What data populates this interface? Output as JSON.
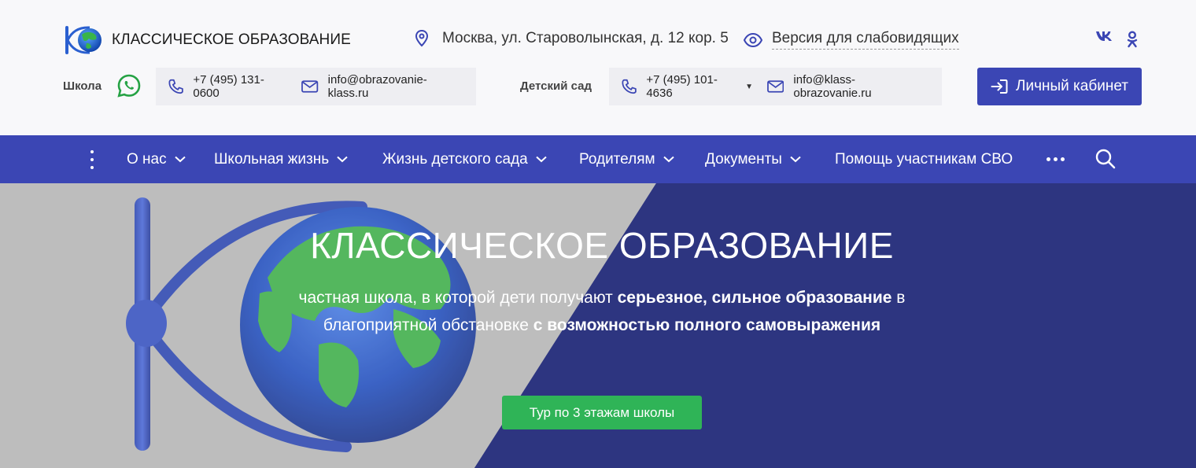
{
  "brand": {
    "name": "КЛАССИЧЕСКОЕ ОБРАЗОВАНИЕ",
    "logo_icon": "globe-logo-icon"
  },
  "header": {
    "address": "Москва, ул. Староволынская, д. 12 кор. 5",
    "vision_link": "Версия для слабовидящих",
    "social": {
      "vk": "vk",
      "ok": "ok-icon"
    },
    "school": {
      "label": "Школа",
      "phone": "+7 (495) 131-0600",
      "email": "info@obrazovanie-klass.ru"
    },
    "kindergarten": {
      "label": "Детский сад",
      "phone": "+7 (495) 101-4636",
      "email": "info@klass-obrazovanie.ru"
    },
    "cabinet_button": "Личный кабинет"
  },
  "nav": {
    "items": [
      {
        "label": "О нас",
        "has_dropdown": true
      },
      {
        "label": "Школьная жизнь",
        "has_dropdown": true
      },
      {
        "label": "Жизнь детского сада",
        "has_dropdown": true
      },
      {
        "label": "Родителям",
        "has_dropdown": true
      },
      {
        "label": "Документы",
        "has_dropdown": true
      },
      {
        "label": "Помощь участникам СВО",
        "has_dropdown": false
      }
    ]
  },
  "hero": {
    "title": "КЛАССИЧЕСКОЕ ОБРАЗОВАНИЕ",
    "subtitle": {
      "part1": "частная школа, в которой дети получают ",
      "bold1": "серьезное, сильное образование",
      "part2": " в благоприятной обстановке ",
      "bold2": "с возможностью полного самовыражения"
    },
    "tour_button": "Тур по 3 этажам школы"
  },
  "colors": {
    "primary": "#3b46b4",
    "hero_dark": "#2d3580",
    "hero_light": "#bdbdbd",
    "accent_green": "#2fb457",
    "whatsapp": "#25a244"
  }
}
